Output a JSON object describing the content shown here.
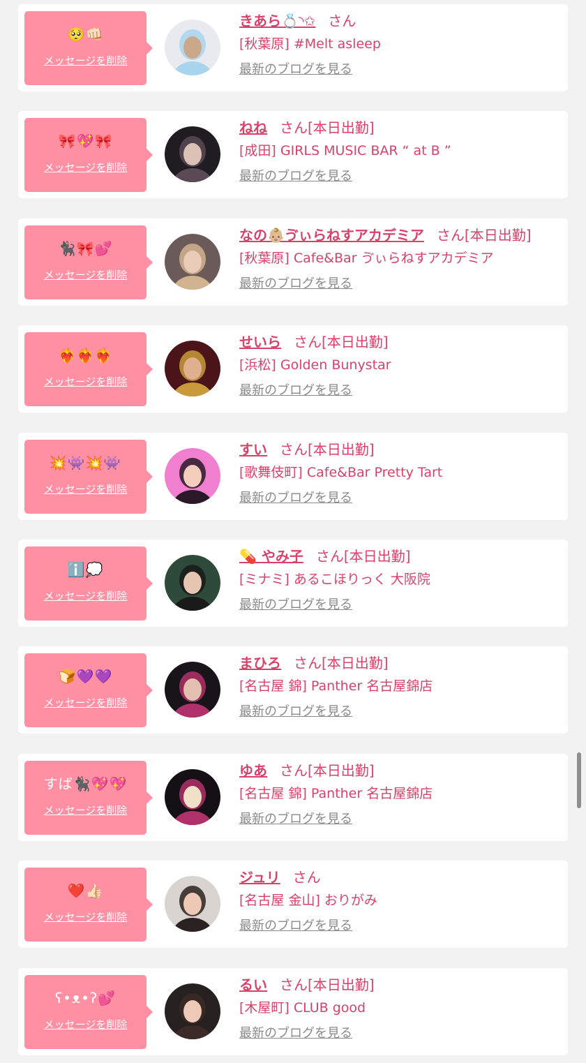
{
  "common": {
    "delete_label": "メッセージを削除",
    "blog_label": "最新のブログを見る",
    "san": "さん"
  },
  "entries": [
    {
      "emoji": "🥺👊🏻",
      "name": "きあら💍◝✩",
      "status": "",
      "shop": "[秋葉原] #Melt asleep",
      "avatar_colors": [
        "#e8eaf0",
        "#c9a98a",
        "#a8d4ee"
      ]
    },
    {
      "emoji": "🎀💖🎀",
      "name": "ねね",
      "status": "[本日出勤]",
      "shop": "[成田] GIRLS MUSIC BAR “ at B ”",
      "avatar_colors": [
        "#1f1c22",
        "#d9c2b5",
        "#5a4a55"
      ]
    },
    {
      "emoji": "🐈‍⬛🎀💕",
      "name": "なの👶🏼ゔぃらねすアカデミア",
      "status": "[本日出勤]",
      "shop": "[秋葉原] Cafe&Bar ゔぃらねすアカデミア",
      "avatar_colors": [
        "#6b5a5a",
        "#e9cbb8",
        "#d2b38f"
      ]
    },
    {
      "emoji": "❤️‍🔥❤️‍🔥❤️‍🔥",
      "name": "せいら",
      "status": "[本日出勤]",
      "shop": "[浜松] Golden Bunystar",
      "avatar_colors": [
        "#4a1418",
        "#e0b08e",
        "#c89a3a"
      ]
    },
    {
      "emoji": "💥👾💥👾",
      "name": "すい",
      "status": "[本日出勤]",
      "shop": "[歌舞伎町] Cafe&Bar Pretty Tart",
      "avatar_colors": [
        "#f07fd0",
        "#f5cdbd",
        "#2a1a28"
      ]
    },
    {
      "emoji": "ℹ️💭",
      "name": "💊 やみ子",
      "status": "[本日出勤]",
      "shop": "[ミナミ] あるこほりっく 大阪院",
      "avatar_colors": [
        "#2e4a3a",
        "#e6c5b3",
        "#1a1a1a"
      ]
    },
    {
      "emoji": "🍞💜💜",
      "name": "まひろ",
      "status": "[本日出勤]",
      "shop": "[名古屋 錦] Panther 名古屋錦店",
      "avatar_colors": [
        "#18141a",
        "#e4c0b0",
        "#b0306a"
      ]
    },
    {
      "emoji": "すば🐈‍⬛💖💖",
      "name": "ゆあ",
      "status": "[本日出勤]",
      "shop": "[名古屋 錦] Panther 名古屋錦店",
      "avatar_colors": [
        "#141014",
        "#f0e0c8",
        "#b0306a"
      ]
    },
    {
      "emoji": "❤️👍🏻",
      "name": "ジュリ",
      "status": "",
      "shop": "[名古屋 金山] おりがみ",
      "avatar_colors": [
        "#d9d4cf",
        "#ecc8b5",
        "#2a2220"
      ]
    },
    {
      "emoji": "ʕ•ᴥ•ʔ💕",
      "name": "るい",
      "status": "[本日出勤]",
      "shop": "[木屋町] CLUB good",
      "avatar_colors": [
        "#262020",
        "#eccab7",
        "#3b2a25"
      ]
    }
  ],
  "colors": {
    "accent": "#d8426a",
    "bubble": "#ff8fa3",
    "background": "#f2f2f2"
  }
}
